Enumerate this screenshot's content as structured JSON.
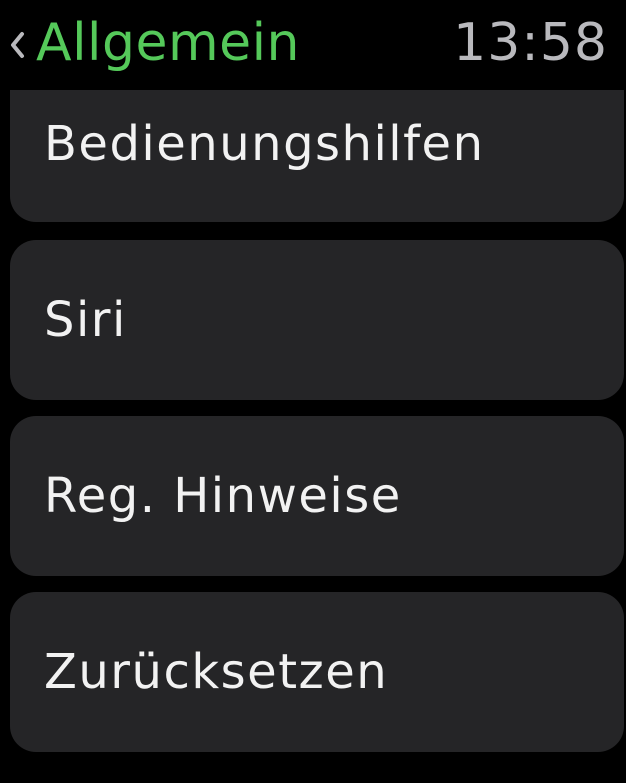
{
  "header": {
    "back_label": "Allgemein",
    "time": "13:58"
  },
  "list": {
    "items": [
      {
        "label": "Bedienungshilfen"
      },
      {
        "label": "Siri"
      },
      {
        "label": "Reg. Hinweise"
      },
      {
        "label": "Zurücksetzen"
      }
    ]
  },
  "colors": {
    "accent": "#55c95a",
    "cell_bg": "#252527",
    "time": "#b9b9bd",
    "background": "#000000"
  }
}
